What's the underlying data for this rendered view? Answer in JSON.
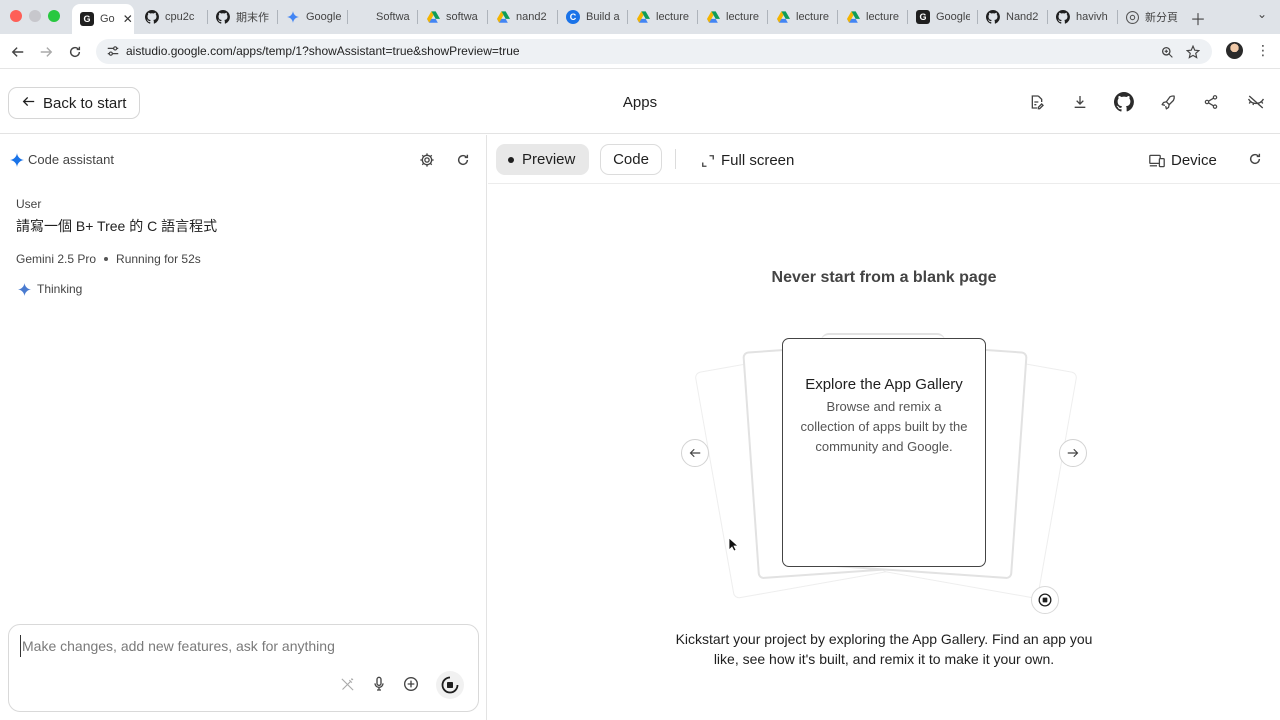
{
  "browser": {
    "tabs": [
      {
        "title": "Go",
        "favicon": "black-square-favicon",
        "active": true
      },
      {
        "title": "cpu2c",
        "favicon": "github-icon"
      },
      {
        "title": "期末作",
        "favicon": "github-icon"
      },
      {
        "title": "Google",
        "favicon": "gemini-spark-icon"
      },
      {
        "title": "Softwa",
        "favicon": "blank-favicon"
      },
      {
        "title": "softwa",
        "favicon": "google-drive-icon"
      },
      {
        "title": "nand2",
        "favicon": "google-drive-icon"
      },
      {
        "title": "Build a",
        "favicon": "blue-c-icon"
      },
      {
        "title": "lecture",
        "favicon": "google-drive-icon"
      },
      {
        "title": "lecture",
        "favicon": "google-drive-icon"
      },
      {
        "title": "lecture",
        "favicon": "google-drive-icon"
      },
      {
        "title": "lecture",
        "favicon": "google-drive-icon"
      },
      {
        "title": "Google",
        "favicon": "black-square-favicon"
      },
      {
        "title": "Nand2",
        "favicon": "github-icon"
      },
      {
        "title": "havivh",
        "favicon": "github-icon"
      },
      {
        "title": "新分頁",
        "favicon": "chrome-icon"
      }
    ],
    "url": "aistudio.google.com/apps/temp/1?showAssistant=true&showPreview=true"
  },
  "header": {
    "back_label": "Back to start",
    "title": "Apps"
  },
  "assistant": {
    "panel_title": "Code assistant",
    "user_label": "User",
    "user_message": "請寫一個 B+ Tree 的 C 語言程式",
    "model_name": "Gemini 2.5 Pro",
    "status": "Running for 52s",
    "thinking_label": "Thinking",
    "input_placeholder": "Make changes, add new features, ask for anything"
  },
  "preview": {
    "tabs": {
      "preview": "Preview",
      "code": "Code"
    },
    "fullscreen_label": "Full screen",
    "device_label": "Device",
    "heading": "Never start from a blank page",
    "card_title": "Explore the App Gallery",
    "card_description": "Browse and remix a collection of apps built by the community and Google.",
    "description": "Kickstart your project by exploring the App Gallery. Find an app you like, see how it's built, and remix it to make it your own."
  },
  "colors": {
    "tabstrip": "#dfe3e8",
    "gemini_blue": "#1a73e8",
    "active_pill": "#e8e8e8"
  }
}
